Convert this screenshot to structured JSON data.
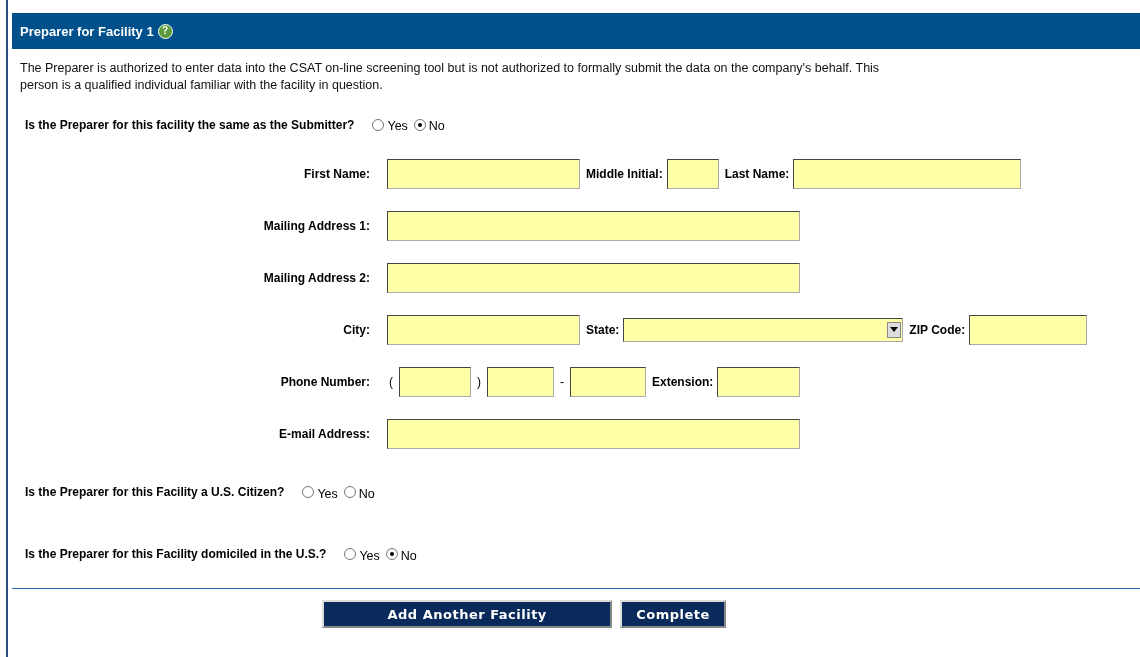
{
  "section": {
    "title": "Preparer for Facility 1",
    "help": "?"
  },
  "description": "The Preparer is authorized to enter data into the CSAT on-line screening tool but is not authorized to formally submit the data on the company's behalf. This person is a qualified individual familiar with the facility in question.",
  "questions_top": [
    {
      "question": "Is the Preparer for this facility the same as the Submitter?",
      "options": [
        {
          "label": "Yes",
          "selected": false
        },
        {
          "label": "No",
          "selected": true
        }
      ]
    }
  ],
  "form_rows": [
    {
      "label": "First Name:",
      "items": [
        {
          "kind": "input"
        },
        {
          "kind": "label",
          "text": "Middle Initial:"
        },
        {
          "kind": "input"
        },
        {
          "kind": "label",
          "text": "Last Name:"
        },
        {
          "kind": "input"
        }
      ]
    },
    {
      "label": "Mailing Address 1:",
      "items": [
        {
          "kind": "input"
        }
      ]
    },
    {
      "label": "Mailing Address 2:",
      "items": [
        {
          "kind": "input"
        }
      ]
    },
    {
      "label": "City:",
      "items": [
        {
          "kind": "input"
        },
        {
          "kind": "label",
          "text": "State:"
        },
        {
          "kind": "select"
        },
        {
          "kind": "label",
          "text": "ZIP Code:"
        },
        {
          "kind": "input"
        }
      ]
    },
    {
      "label": "Phone Number:",
      "items": [
        {
          "kind": "symbol",
          "text": "("
        },
        {
          "kind": "input"
        },
        {
          "kind": "symbol",
          "text": ")"
        },
        {
          "kind": "input"
        },
        {
          "kind": "symbol",
          "text": "-"
        },
        {
          "kind": "input"
        },
        {
          "kind": "label",
          "text": "Extension:"
        },
        {
          "kind": "input"
        }
      ]
    },
    {
      "label": "E-mail Address:",
      "items": [
        {
          "kind": "input"
        }
      ]
    }
  ],
  "questions_bottom": [
    {
      "question": "Is the Preparer for this Facility a U.S. Citizen?",
      "options": [
        {
          "label": "Yes",
          "selected": false
        },
        {
          "label": "No",
          "selected": false
        }
      ]
    },
    {
      "question": "Is the Preparer for this Facility domiciled in the U.S.?",
      "options": [
        {
          "label": "Yes",
          "selected": false
        },
        {
          "label": "No",
          "selected": true
        }
      ]
    }
  ],
  "buttons": [
    "Add Another Facility",
    "Complete"
  ]
}
